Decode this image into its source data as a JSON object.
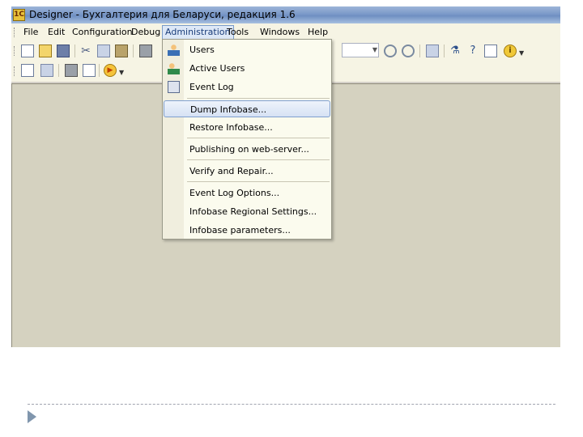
{
  "window": {
    "title": "Designer - Бухгалтерия для Беларуси, редакция 1.6"
  },
  "menubar": {
    "items": [
      {
        "label": "File"
      },
      {
        "label": "Edit"
      },
      {
        "label": "Configuration"
      },
      {
        "label": "Debug"
      },
      {
        "label": "Administration"
      },
      {
        "label": "Tools"
      },
      {
        "label": "Windows"
      },
      {
        "label": "Help"
      }
    ]
  },
  "administration_menu": {
    "items": [
      {
        "label": "Users",
        "icon": "user-icon"
      },
      {
        "label": "Active Users",
        "icon": "active-users-icon"
      },
      {
        "label": "Event Log",
        "icon": "event-log-icon"
      },
      {
        "label": "Dump Infobase..."
      },
      {
        "label": "Restore Infobase..."
      },
      {
        "label": "Publishing on web-server..."
      },
      {
        "label": "Verify and Repair..."
      },
      {
        "label": "Event Log Options..."
      },
      {
        "label": "Infobase Regional Settings..."
      },
      {
        "label": "Infobase parameters..."
      }
    ],
    "highlighted": "Dump Infobase..."
  },
  "colors": {
    "titlebar": "#7b99c8",
    "menubar": "#f6f4e4",
    "workarea": "#d5d2c0",
    "highlight_border": "#7f9fcf"
  }
}
